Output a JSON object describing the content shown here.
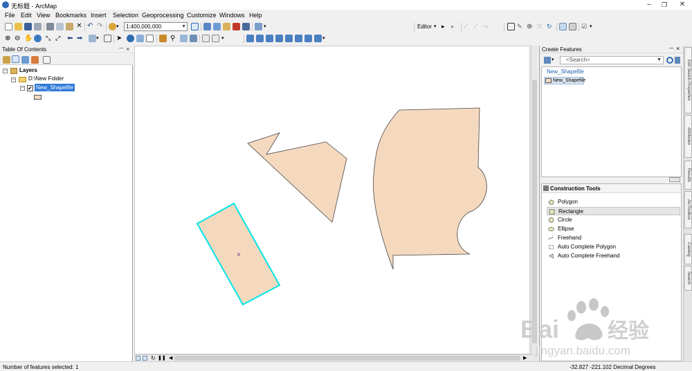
{
  "window": {
    "title": "无标题 - ArcMap",
    "minimize": "–",
    "maximize": "❐",
    "close": "✕"
  },
  "menu": [
    "File",
    "Edit",
    "View",
    "Bookmarks",
    "Insert",
    "Selection",
    "Geoprocessing",
    "Customize",
    "Windows",
    "Help"
  ],
  "toolbar": {
    "scale_value": "1:400,000,000",
    "editor_label": "Editor"
  },
  "toc": {
    "title": "Table Of Contents",
    "pin": "𝄖",
    "close": "×",
    "layers_label": "Layers",
    "folder_label": "D:\\New Folder",
    "layer_label": "New_Shapefile",
    "layer_checked": true,
    "symbol_color": "#f5d9bf"
  },
  "map": {
    "polygon_fill": "#f5d9bf",
    "polygon_stroke": "#444444",
    "selection_stroke": "#00e5e5",
    "selected_feature_center": "×"
  },
  "create_features": {
    "title": "Create Features",
    "search_placeholder": "<Search>",
    "template_group": "New_Shapefile",
    "template_item": "New_Shapefile",
    "construction_title": "Construction Tools",
    "tools": [
      {
        "label": "Polygon",
        "icon": "polygon-icon",
        "selected": false
      },
      {
        "label": "Rectangle",
        "icon": "rectangle-icon",
        "selected": true
      },
      {
        "label": "Circle",
        "icon": "circle-icon",
        "selected": false
      },
      {
        "label": "Ellipse",
        "icon": "ellipse-icon",
        "selected": false
      },
      {
        "label": "Freehand",
        "icon": "freehand-icon",
        "selected": false
      },
      {
        "label": "Auto Complete Polygon",
        "icon": "auto-complete-polygon-icon",
        "selected": false
      },
      {
        "label": "Auto Complete Freehand",
        "icon": "auto-complete-freehand-icon",
        "selected": false
      }
    ]
  },
  "side_tabs": [
    "Edit Sketch Properties",
    "Attributes",
    "Results",
    "ArcToolbox",
    "Catalog",
    "Search"
  ],
  "status": {
    "selection_text": "Number of features selected: 1",
    "coordinates": "-32.827  -221.102 Decimal Degrees"
  },
  "watermark": {
    "brand": "Bai",
    "brand_cn": "经验",
    "url": "jingyan.baidu.com"
  }
}
